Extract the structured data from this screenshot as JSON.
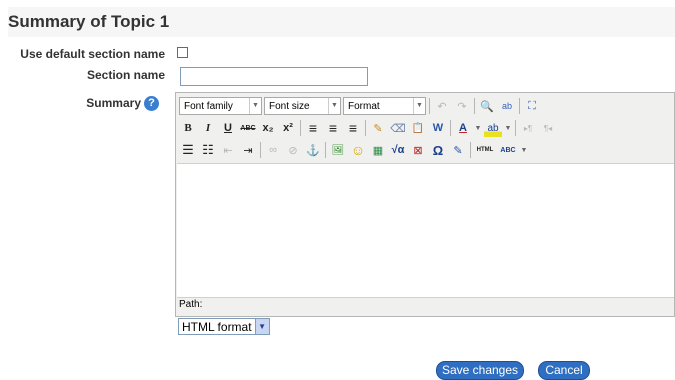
{
  "page": {
    "title": "Summary of Topic 1"
  },
  "form": {
    "use_default_label": "Use default section name",
    "use_default_checked": false,
    "section_name_label": "Section name",
    "section_name_value": "",
    "summary_label": "Summary",
    "help_glyph": "?"
  },
  "editor": {
    "font_family": "Font family",
    "font_size": "Font size",
    "format": "Format",
    "path_label": "Path:",
    "content": ""
  },
  "toolbar_icons": {
    "bold": "B",
    "italic": "I",
    "underline": "U",
    "strike": "ABC",
    "sub": "x₂",
    "sup": "x²",
    "undo": "↶",
    "redo": "↷",
    "find": "🔍",
    "replace": "ab",
    "fullscreen": "⛶",
    "align_left": "≡",
    "align_center": "≡",
    "align_right": "≡",
    "cleanup": "✎",
    "eraser": "⌫",
    "paste": "📋",
    "paste_word": "W",
    "font_color": "A",
    "highlight": "ab",
    "ltr": "▸¶",
    "rtl": "¶◂",
    "bullets": "☰",
    "numbers": "☷",
    "outdent": "⇤",
    "indent": "⇥",
    "link": "∞",
    "unlink": "⊘",
    "anchor": "⚓",
    "image": "🖼",
    "emoticon": "☺",
    "media": "▦",
    "equation": "√α",
    "nolink": "⊠",
    "omega": "Ω",
    "edit": "✎",
    "html": "HTML",
    "spell": "ABC"
  },
  "text_format": {
    "value": "HTML format"
  },
  "actions": {
    "save": "Save changes",
    "cancel": "Cancel"
  }
}
